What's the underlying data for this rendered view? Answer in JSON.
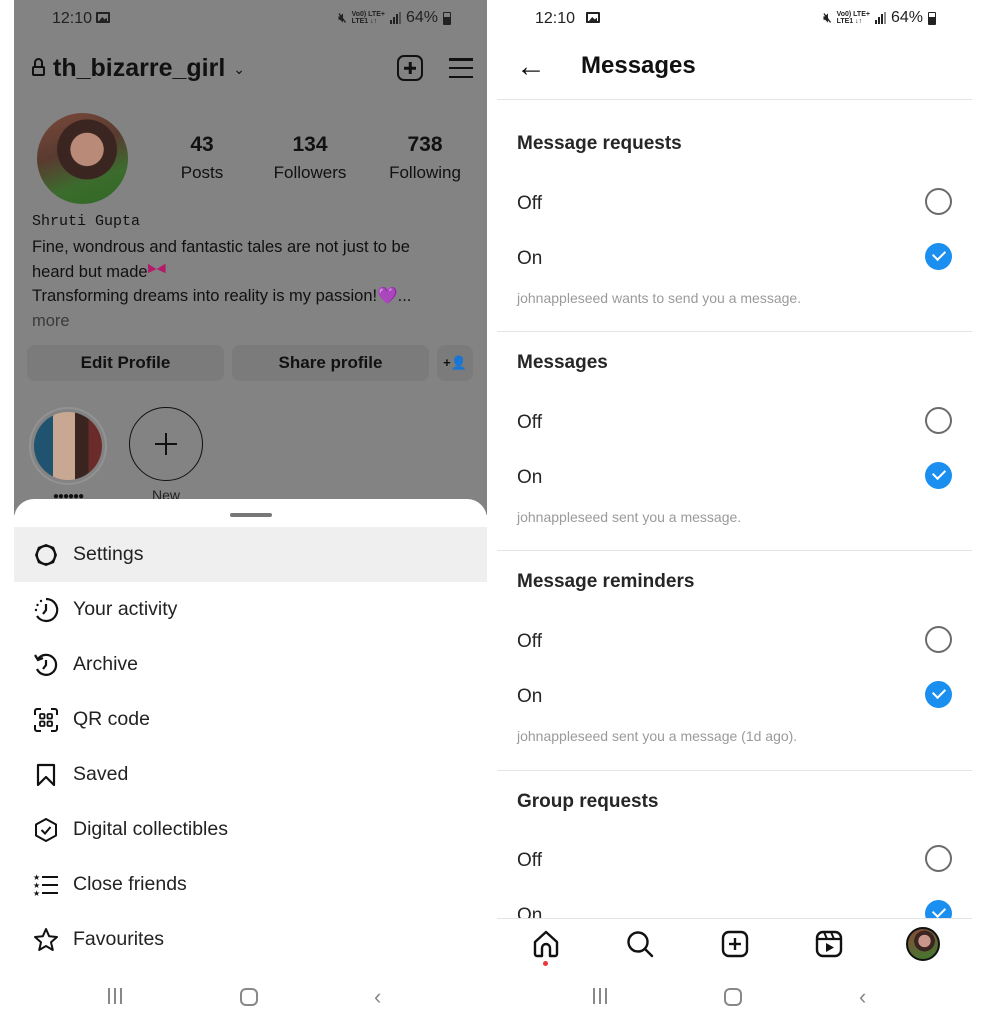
{
  "left_screen": {
    "status_bar": {
      "time": "12:10",
      "network": "Vo0) LTE+ LTE1",
      "battery": "64%"
    },
    "header": {
      "username": "th_bizarre_girl",
      "icons": [
        "lock-icon",
        "chevron-down-icon",
        "new-post-icon",
        "menu-icon"
      ]
    },
    "profile": {
      "stats": [
        {
          "value": "43",
          "label": "Posts"
        },
        {
          "value": "134",
          "label": "Followers"
        },
        {
          "value": "738",
          "label": "Following"
        }
      ],
      "full_name": "Shruti Gupta",
      "bio_line1": "Fine, wondrous and fantastic tales are not just to be",
      "bio_line2": "heard but made",
      "bio_line3": "Transforming dreams into reality is my passion!",
      "bio_ellipsis": "...",
      "more_label": "more",
      "heart_emoji": "💜"
    },
    "buttons": {
      "edit_profile": "Edit Profile",
      "share_profile": "Share profile",
      "discover_people": "+👤"
    },
    "highlights": [
      {
        "label": "●●●●●●"
      },
      {
        "label": "New"
      }
    ],
    "sheet_menu": [
      {
        "label": "Settings",
        "icon": "settings-icon",
        "active": true
      },
      {
        "label": "Your activity",
        "icon": "activity-icon"
      },
      {
        "label": "Archive",
        "icon": "archive-icon"
      },
      {
        "label": "QR code",
        "icon": "qr-code-icon"
      },
      {
        "label": "Saved",
        "icon": "bookmark-icon"
      },
      {
        "label": "Digital collectibles",
        "icon": "collectibles-icon"
      },
      {
        "label": "Close friends",
        "icon": "close-friends-icon"
      },
      {
        "label": "Favourites",
        "icon": "star-icon"
      }
    ]
  },
  "right_screen": {
    "status_bar": {
      "time": "12:10",
      "network": "Vo0) LTE+ LTE1",
      "battery": "64%"
    },
    "title": "Messages",
    "sections": [
      {
        "title": "Message requests",
        "off_label": "Off",
        "on_label": "On",
        "selected": "On",
        "description": "johnappleseed wants to send you a message."
      },
      {
        "title": "Messages",
        "off_label": "Off",
        "on_label": "On",
        "selected": "On",
        "description": "johnappleseed sent you a message."
      },
      {
        "title": "Message reminders",
        "off_label": "Off",
        "on_label": "On",
        "selected": "On",
        "description": "johnappleseed sent you a message (1d ago)."
      },
      {
        "title": "Group requests",
        "off_label": "Off",
        "on_label": "On",
        "selected": "On",
        "description": ""
      }
    ],
    "bottom_nav": [
      "home-icon",
      "search-icon",
      "create-icon",
      "reels-icon",
      "profile-avatar"
    ],
    "accent_color": "#1a8ff0"
  }
}
